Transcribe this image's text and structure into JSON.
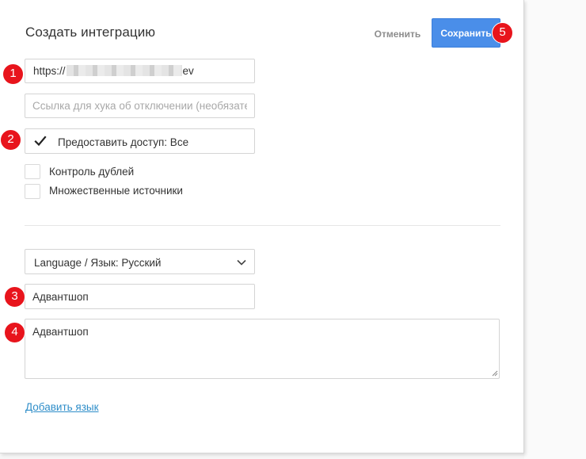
{
  "modal": {
    "title": "Создать интеграцию",
    "cancel_label": "Отменить",
    "save_label": "Сохранить"
  },
  "form": {
    "webhook_url_prefix": "https://",
    "webhook_url_suffix": "ev",
    "unsubscribe_placeholder": "Ссылка для хука об отключении (необязательно)",
    "access_label": "Предоставить доступ: Все",
    "access_checked": true,
    "checkboxes": [
      {
        "label": "Контроль дублей",
        "checked": false
      },
      {
        "label": "Множественные источники",
        "checked": false
      }
    ],
    "language_label": "Language / Язык: Русский",
    "name_value": "Адвантшоп",
    "description_value": "Адвантшоп",
    "add_language_label": "Добавить язык"
  },
  "annotations": [
    "1",
    "2",
    "3",
    "4",
    "5"
  ],
  "colors": {
    "primary": "#4a8ee9",
    "link": "#2f8ec9",
    "badge": "#e8141c"
  }
}
